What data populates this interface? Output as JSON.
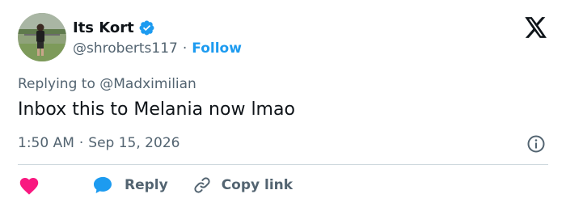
{
  "author": {
    "name": "Its Kort",
    "handle": "@shroberts117",
    "separator": "·",
    "follow_label": "Follow",
    "verified_icon": "verified-badge-icon",
    "avatar_icon": "avatar"
  },
  "tweet": {
    "replying_to": "Replying to @Madximilian",
    "text": "Inbox this to Melania now lmao",
    "time": "1:50 AM",
    "separator": "·",
    "date": "Sep 15, 2026"
  },
  "actions": {
    "reply_label": "Reply",
    "copy_link_label": "Copy link"
  },
  "colors": {
    "accent": "#1d9bf0",
    "heart": "#f91880",
    "muted": "#536471",
    "text": "#0f1419",
    "divider": "#cfd9de"
  }
}
